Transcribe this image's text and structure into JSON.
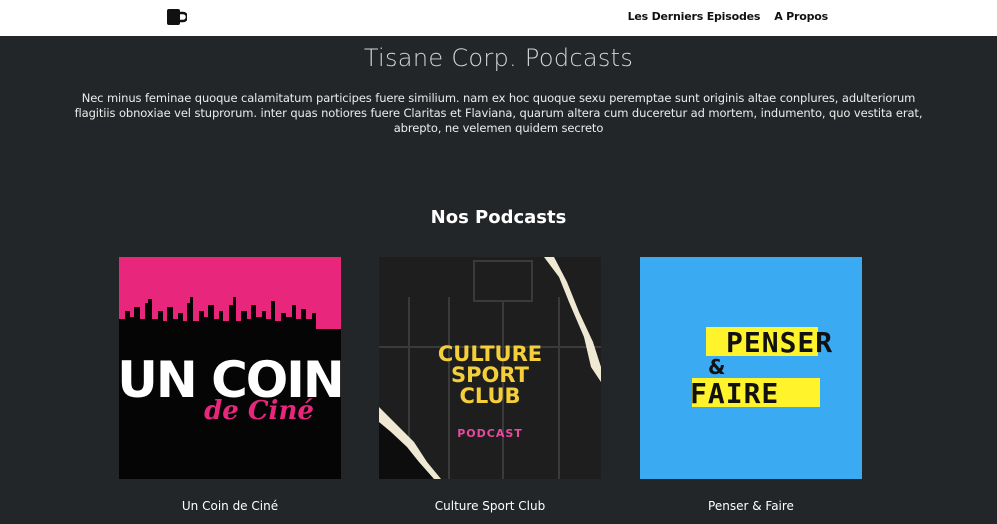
{
  "nav": {
    "logo_icon": "coffee-mug-icon",
    "links": [
      {
        "label": "Les Derniers Episodes"
      },
      {
        "label": "A Propos"
      }
    ]
  },
  "hero": {
    "title": "Tisane Corp. Podcasts",
    "intro": "Nec minus feminae quoque calamitatum participes fuere similium. nam ex hoc quoque sexu peremptae sunt originis altae conplures, adulteriorum flagitiis obnoxiae vel stuprorum. inter quas notiores fuere Claritas et Flaviana, quarum altera cum duceretur ad mortem, indumento, quo vestita erat, abrepto, ne velemen quidem secreto"
  },
  "podcasts": {
    "heading": "Nos Podcasts",
    "items": [
      {
        "title": "Un Coin de Ciné",
        "cover_lines": [
          "UN COIN",
          "de Ciné"
        ],
        "colors": {
          "sky": "#e8267b",
          "ground": "#050505",
          "script": "#e8267b"
        }
      },
      {
        "title": "Culture Sport Club",
        "cover_lines": [
          "CULTURE",
          "SPORT",
          "CLUB",
          "PODCAST"
        ],
        "colors": {
          "bg": "#1a1a1a",
          "text": "#f4cf3a",
          "tag": "#e84aa0"
        }
      },
      {
        "title": "Penser & Faire",
        "cover_lines": [
          "PENSER",
          "&",
          "FAIRE"
        ],
        "colors": {
          "bg": "#3aabf3",
          "highlight": "#fff32b",
          "text": "#111111"
        }
      }
    ]
  },
  "colors": {
    "page_bg": "#232628",
    "nav_bg": "#ffffff"
  }
}
